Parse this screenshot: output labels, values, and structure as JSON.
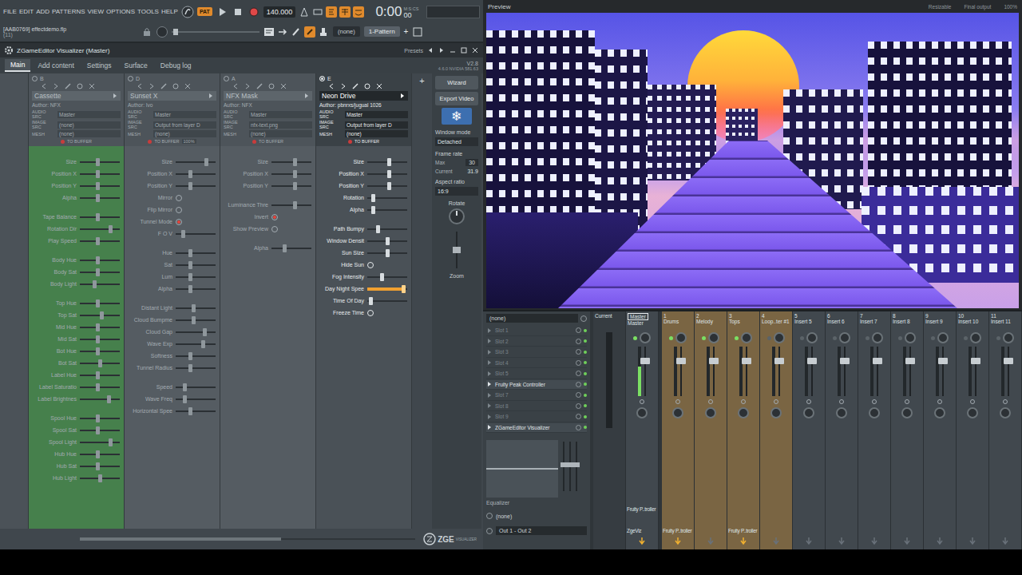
{
  "toolbar": {
    "menus": [
      "FILE",
      "EDIT",
      "ADD",
      "PATTERNS",
      "VIEW",
      "OPTIONS",
      "TOOLS",
      "HELP"
    ],
    "mode": "PAT",
    "tempo": "140.000",
    "time": "0:00",
    "time_fraction": "00",
    "time_unit": "M:S:CS",
    "project": "[AAB0769] effectdemo.flp",
    "hint": "(11)",
    "pattern_source": "(none)",
    "pattern": "1-Pattern",
    "pattern_add": "+"
  },
  "plugin": {
    "title": "ZGameEditor Visualizer (Master)",
    "presets": "Presets",
    "tabs": [
      {
        "label": "Main",
        "selected": true
      },
      {
        "label": "Add content",
        "selected": false
      },
      {
        "label": "Settings",
        "selected": false
      },
      {
        "label": "Surface",
        "selected": false
      },
      {
        "label": "Debug log",
        "selected": false
      }
    ],
    "version": "V2.8",
    "gpu": "4.6.0 NVIDIA 581.63",
    "add_layer": "+",
    "layers": [
      {
        "letter": "B",
        "name": "Cassette",
        "selected": false,
        "color": "#46804c",
        "author": "Author: NFX",
        "fields": [
          {
            "label": "AUDIO SRC",
            "value": "Master"
          },
          {
            "label": "IMAGE SRC",
            "value": "(none)"
          },
          {
            "label": "MESH",
            "value": "(none)"
          }
        ],
        "buffer": "TO BUFFER",
        "buffer_pct": "",
        "groups": [
          [
            {
              "label": "Size",
              "kind": "slider",
              "level": 0.45,
              "hot": false
            },
            {
              "label": "Position X",
              "kind": "slider",
              "level": 0.45,
              "hot": false
            },
            {
              "label": "Position Y",
              "kind": "slider",
              "level": 0.45,
              "hot": false
            },
            {
              "label": "Alpha",
              "kind": "slider",
              "level": 0.45,
              "hot": false
            }
          ],
          [
            {
              "label": "Tape Balance",
              "kind": "slider",
              "level": 0.45,
              "hot": false
            },
            {
              "label": "Rotation Dir",
              "kind": "slider",
              "level": 0.8,
              "hot": false
            },
            {
              "label": "Play Speed",
              "kind": "slider",
              "level": 0.45,
              "hot": false
            }
          ],
          [
            {
              "label": "Body Hue",
              "kind": "slider",
              "level": 0.45,
              "hot": false
            },
            {
              "label": "Body Sat",
              "kind": "slider",
              "level": 0.45,
              "hot": false
            },
            {
              "label": "Body Light",
              "kind": "slider",
              "level": 0.35,
              "hot": false
            }
          ],
          [
            {
              "label": "Top Hue",
              "kind": "slider",
              "level": 0.45,
              "hot": false
            },
            {
              "label": "Top Sat",
              "kind": "slider",
              "level": 0.55,
              "hot": false
            },
            {
              "label": "Mid Hue",
              "kind": "slider",
              "level": 0.45,
              "hot": false
            },
            {
              "label": "Mid Sat",
              "kind": "slider",
              "level": 0.45,
              "hot": false
            },
            {
              "label": "Bot Hue",
              "kind": "slider",
              "level": 0.45,
              "hot": false
            },
            {
              "label": "Bot Sat",
              "kind": "slider",
              "level": 0.5,
              "hot": false
            },
            {
              "label": "Label Hue",
              "kind": "slider",
              "level": 0.45,
              "hot": false
            },
            {
              "label": "Label Saturatio",
              "kind": "slider",
              "level": 0.45,
              "hot": false
            },
            {
              "label": "Label Brightnes",
              "kind": "slider",
              "level": 0.75,
              "hot": false
            }
          ],
          [
            {
              "label": "Spool Hue",
              "kind": "slider",
              "level": 0.45,
              "hot": false
            },
            {
              "label": "Spool Sat",
              "kind": "slider",
              "level": 0.45,
              "hot": false
            },
            {
              "label": "Spool Light",
              "kind": "slider",
              "level": 0.8,
              "hot": false
            },
            {
              "label": "Hub Hue",
              "kind": "slider",
              "level": 0.45,
              "hot": false
            },
            {
              "label": "Hub Sat",
              "kind": "slider",
              "level": 0.45,
              "hot": false
            },
            {
              "label": "Hub Light",
              "kind": "slider",
              "level": 0.5,
              "hot": false
            }
          ]
        ]
      },
      {
        "letter": "D",
        "name": "Sunset X",
        "selected": false,
        "color": "#555c62",
        "author": "Author: Ivo",
        "fields": [
          {
            "label": "AUDIO SRC",
            "value": "Master"
          },
          {
            "label": "IMAGE SRC",
            "value": "Output from layer D"
          },
          {
            "label": "MESH",
            "value": "(none)"
          }
        ],
        "buffer": "TO BUFFER",
        "buffer_pct": "100%",
        "groups": [
          [
            {
              "label": "Size",
              "kind": "slider",
              "level": 0.8,
              "hot": false
            },
            {
              "label": "Position X",
              "kind": "slider",
              "level": 0.35,
              "hot": false
            },
            {
              "label": "Position Y",
              "kind": "slider",
              "level": 0.35,
              "hot": false
            },
            {
              "label": "Mirror",
              "kind": "toggle",
              "on": false,
              "hot": false
            },
            {
              "label": "Flip Mirror",
              "kind": "toggle",
              "on": false,
              "hot": false
            },
            {
              "label": "Tunnel Mode",
              "kind": "toggle",
              "on": true,
              "hot": false
            },
            {
              "label": "F O V",
              "kind": "slider",
              "level": 0.15,
              "hot": false
            }
          ],
          [
            {
              "label": "Hue",
              "kind": "slider",
              "level": 0.35,
              "hot": false
            },
            {
              "label": "Sat",
              "kind": "slider",
              "level": 0.35,
              "hot": false
            },
            {
              "label": "Lum",
              "kind": "slider",
              "level": 0.35,
              "hot": false
            },
            {
              "label": "Alpha",
              "kind": "slider",
              "level": 0.35,
              "hot": false
            }
          ],
          [
            {
              "label": "Distant Light",
              "kind": "slider",
              "level": 0.45,
              "hot": false
            },
            {
              "label": "Cloud Bumpme",
              "kind": "slider",
              "level": 0.45,
              "hot": false
            },
            {
              "label": "Cloud Gap",
              "kind": "slider",
              "level": 0.75,
              "hot": false
            },
            {
              "label": "Wave Exp",
              "kind": "slider",
              "level": 0.7,
              "hot": false
            },
            {
              "label": "Softness",
              "kind": "slider",
              "level": 0.35,
              "hot": false
            },
            {
              "label": "Tunnel Radius",
              "kind": "slider",
              "level": 0.35,
              "hot": false
            }
          ],
          [
            {
              "label": "Speed",
              "kind": "slider",
              "level": 0.2,
              "hot": false
            },
            {
              "label": "Wave Freq",
              "kind": "slider",
              "level": 0.2,
              "hot": false
            },
            {
              "label": "Horizontal Spee",
              "kind": "slider",
              "level": 0.35,
              "hot": false
            }
          ]
        ]
      },
      {
        "letter": "A",
        "name": "NFX Mask",
        "selected": false,
        "color": "#555c62",
        "author": "Author: NFX",
        "fields": [
          {
            "label": "AUDIO SRC",
            "value": "Master"
          },
          {
            "label": "IMAGE SRC",
            "value": "nfx-text.png"
          },
          {
            "label": "MESH",
            "value": "(none)"
          }
        ],
        "buffer": "TO BUFFER",
        "buffer_pct": "",
        "groups": [
          [
            {
              "label": "Size",
              "kind": "slider",
              "level": 0.6,
              "hot": false
            },
            {
              "label": "Position X",
              "kind": "slider",
              "level": 0.6,
              "hot": false
            },
            {
              "label": "Position Y",
              "kind": "slider",
              "level": 0.6,
              "hot": false
            }
          ],
          [
            {
              "label": "Luminance Thre",
              "kind": "slider",
              "level": 0.6,
              "hot": false
            },
            {
              "label": "Invert",
              "kind": "toggle",
              "on": true,
              "hot": false
            },
            {
              "label": "Show Preview",
              "kind": "toggle",
              "on": false,
              "hot": false
            }
          ],
          [
            {
              "label": "Alpha",
              "kind": "slider",
              "level": 0.3,
              "hot": false
            }
          ]
        ]
      },
      {
        "letter": "E",
        "name": "Neon Drive",
        "selected": true,
        "color": "#4a5157",
        "author": "Author: pbnrxs/jugual 1026",
        "fields": [
          {
            "label": "AUDIO SRC",
            "value": "Master"
          },
          {
            "label": "IMAGE SRC",
            "value": "Output from layer D"
          },
          {
            "label": "MESH",
            "value": "(none)"
          }
        ],
        "buffer": "TO BUFFER",
        "buffer_pct": "",
        "groups": [
          [
            {
              "label": "Size",
              "kind": "slider",
              "level": 0.55,
              "hot": false
            },
            {
              "label": "Position X",
              "kind": "slider",
              "level": 0.55,
              "hot": false
            },
            {
              "label": "Position Y",
              "kind": "slider",
              "level": 0.55,
              "hot": false
            },
            {
              "label": "Rotation",
              "kind": "slider",
              "level": 0.1,
              "hot": false
            },
            {
              "label": "Alpha",
              "kind": "slider",
              "level": 0.1,
              "hot": false
            }
          ],
          [
            {
              "label": "Path Bumpy",
              "kind": "slider",
              "level": 0.25,
              "hot": false
            },
            {
              "label": "Window Densit",
              "kind": "slider",
              "level": 0.5,
              "hot": false
            },
            {
              "label": "Sun Size",
              "kind": "slider",
              "level": 0.5,
              "hot": false
            },
            {
              "label": "Hide Sun",
              "kind": "toggle",
              "on": false,
              "hot": false
            },
            {
              "label": "Fog Intensity",
              "kind": "slider",
              "level": 0.35,
              "hot": false
            },
            {
              "label": "Day Night Spee",
              "kind": "slider",
              "level": 0.95,
              "hot": true
            },
            {
              "label": "Time Of Day",
              "kind": "slider",
              "level": 0.05,
              "hot": false
            },
            {
              "label": "Freeze Time",
              "kind": "toggle",
              "on": false,
              "hot": false
            }
          ]
        ]
      }
    ],
    "sidebar": {
      "wizard": "Wizard",
      "export": "Export Video",
      "freeze_glyph": "❄",
      "window_mode_label": "Window mode",
      "window_mode": "Detached",
      "frame_rate_label": "Frame rate",
      "max_label": "Max",
      "max": "30",
      "current_label": "Current",
      "current": "31.9",
      "aspect_label": "Aspect ratio",
      "aspect": "16:9",
      "rotate_label": "Rotate",
      "zoom_label": "Zoom",
      "zoom_level": 0.5
    },
    "logo": "ZGE",
    "logo_sub": "VISUALIZER"
  },
  "preview": {
    "title": "Preview",
    "mode": "Resizable",
    "output": "Final output",
    "zoom": "100%"
  },
  "mixer": {
    "preset": "(none)",
    "slots": [
      {
        "name": "Slot 1",
        "filled": false
      },
      {
        "name": "Slot 2",
        "filled": false
      },
      {
        "name": "Slot 3",
        "filled": false
      },
      {
        "name": "Slot 4",
        "filled": false
      },
      {
        "name": "Slot 5",
        "filled": false
      },
      {
        "name": "Fruity Peak Controller",
        "filled": true
      },
      {
        "name": "Slot 7",
        "filled": false
      },
      {
        "name": "Slot 8",
        "filled": false
      },
      {
        "name": "Slot 9",
        "filled": false
      },
      {
        "name": "ZGameEditor Visualizer",
        "filled": true
      }
    ],
    "eq_label": "Equalizer",
    "eq_levels": [
      0.55,
      0.55,
      0.55
    ],
    "input": "(none)",
    "output": "Out 1 - Out 2",
    "tracks": [
      {
        "number": "Current",
        "name": "",
        "kind": "current",
        "selected": false,
        "routed": false,
        "led": false,
        "level": 0,
        "meter": 0,
        "send": false,
        "fx": []
      },
      {
        "number": "Master",
        "name": "Master",
        "kind": "master",
        "selected": true,
        "routed": false,
        "led": true,
        "level": 0.75,
        "meter": 0.6,
        "send": true,
        "fx": [
          "Fruity P..troller",
          "ZgeViz"
        ]
      },
      {
        "number": "1",
        "name": "Drums",
        "kind": "insert",
        "selected": false,
        "routed": true,
        "led": true,
        "level": 0.75,
        "meter": 0,
        "send": true,
        "fx": [
          "Fruity P..troller"
        ]
      },
      {
        "number": "2",
        "name": "Melody",
        "kind": "insert",
        "selected": false,
        "routed": true,
        "led": true,
        "level": 0.75,
        "meter": 0,
        "send": false,
        "fx": []
      },
      {
        "number": "3",
        "name": "Tops",
        "kind": "insert",
        "selected": false,
        "routed": true,
        "led": true,
        "level": 0.75,
        "meter": 0,
        "send": true,
        "fx": [
          "Fruity P..troller"
        ]
      },
      {
        "number": "4",
        "name": "Loop..ter #1",
        "kind": "insert",
        "selected": false,
        "routed": true,
        "led": false,
        "level": 0.75,
        "meter": 0,
        "send": false,
        "fx": []
      },
      {
        "number": "5",
        "name": "Insert 5",
        "kind": "insert",
        "selected": false,
        "routed": false,
        "led": false,
        "level": 0.75,
        "meter": 0,
        "send": false,
        "fx": []
      },
      {
        "number": "6",
        "name": "Insert 6",
        "kind": "insert",
        "selected": false,
        "routed": false,
        "led": false,
        "level": 0.75,
        "meter": 0,
        "send": false,
        "fx": []
      },
      {
        "number": "7",
        "name": "Insert 7",
        "kind": "insert",
        "selected": false,
        "routed": false,
        "led": false,
        "level": 0.75,
        "meter": 0,
        "send": false,
        "fx": []
      },
      {
        "number": "8",
        "name": "Insert 8",
        "kind": "insert",
        "selected": false,
        "routed": false,
        "led": false,
        "level": 0.75,
        "meter": 0,
        "send": false,
        "fx": []
      },
      {
        "number": "9",
        "name": "Insert 9",
        "kind": "insert",
        "selected": false,
        "routed": false,
        "led": false,
        "level": 0.75,
        "meter": 0,
        "send": false,
        "fx": []
      },
      {
        "number": "10",
        "name": "Insert 10",
        "kind": "insert",
        "selected": false,
        "routed": false,
        "led": false,
        "level": 0.75,
        "meter": 0,
        "send": false,
        "fx": []
      },
      {
        "number": "11",
        "name": "Insert 11",
        "kind": "insert",
        "selected": false,
        "routed": false,
        "led": false,
        "level": 0.75,
        "meter": 0,
        "send": false,
        "fx": []
      }
    ]
  }
}
